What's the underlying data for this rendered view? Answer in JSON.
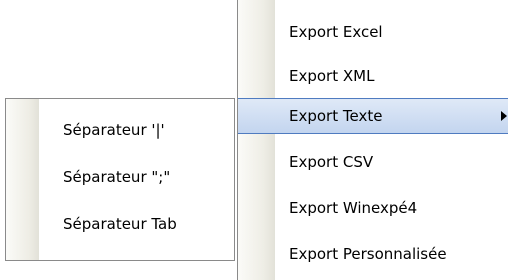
{
  "main_menu": {
    "items": [
      {
        "label": "Export Excel"
      },
      {
        "label": "Export XML"
      },
      {
        "label": "Export Texte",
        "highlighted": true,
        "has_submenu": true
      },
      {
        "label": "Export CSV"
      },
      {
        "label": "Export Winexpé4"
      },
      {
        "label": "Export Personnalisée"
      }
    ]
  },
  "sub_menu": {
    "items": [
      {
        "label": "Séparateur '|'"
      },
      {
        "label": "Séparateur \";\""
      },
      {
        "label": "Séparateur Tab"
      }
    ]
  },
  "colors": {
    "highlight_border": "#4f7bc0",
    "highlight_fill": "#c3d5ef",
    "menu_border": "#8a8a8a"
  },
  "icons": {
    "submenu_indicator": "chevron-right-icon"
  }
}
